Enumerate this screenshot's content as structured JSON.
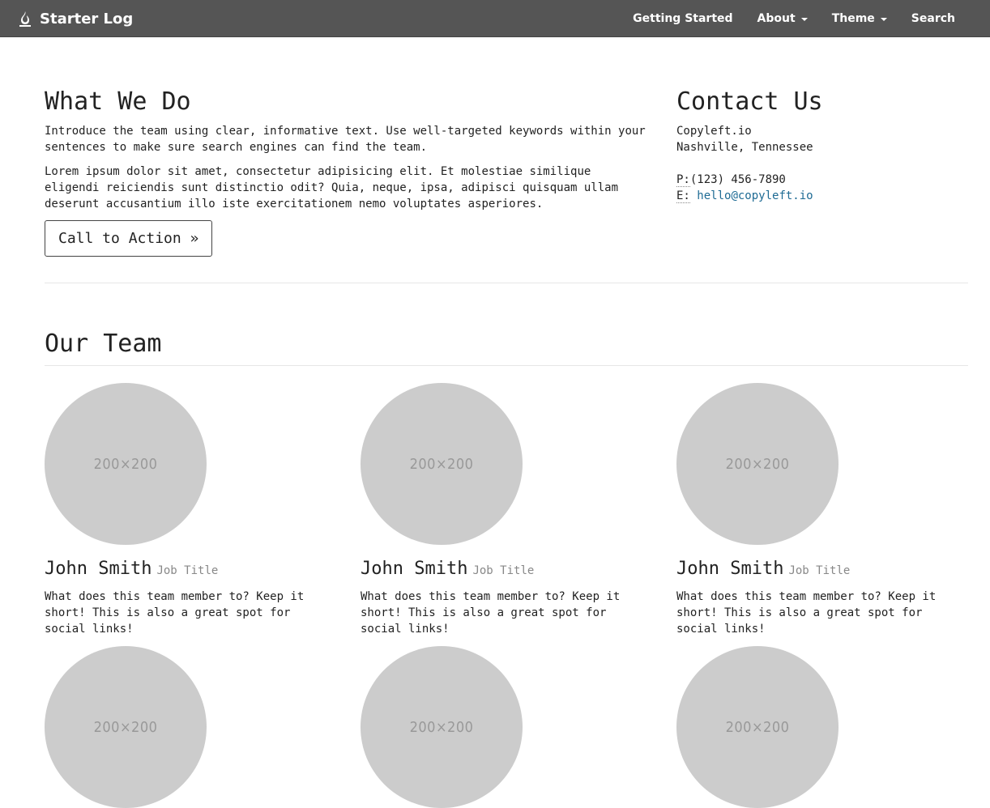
{
  "navbar": {
    "brand": "Starter Log",
    "links": [
      {
        "label": "Getting Started"
      },
      {
        "label": "About"
      },
      {
        "label": "Theme"
      },
      {
        "label": "Search"
      }
    ]
  },
  "what_we_do": {
    "heading": "What We Do",
    "paragraph_1": "Introduce the team using clear, informative text. Use well-targeted keywords within your sentences to make sure search engines can find the team.",
    "paragraph_2": "Lorem ipsum dolor sit amet, consectetur adipisicing elit. Et molestiae similique eligendi reiciendis sunt distinctio odit? Quia, neque, ipsa, adipisci quisquam ullam deserunt accusantium illo iste exercitationem nemo voluptates asperiores.",
    "cta_label": "Call to Action »"
  },
  "contact": {
    "heading": "Contact Us",
    "company": "Copyleft.io",
    "location": "Nashville, Tennessee",
    "phone_label": "P:",
    "phone": "(123) 456-7890",
    "email_label": "E:",
    "email": "hello@copyleft.io",
    "link_color": "#1e6b94"
  },
  "team": {
    "heading": "Our Team",
    "members": [
      {
        "avatar": "200×200",
        "name": "John Smith",
        "title": "Job Title",
        "description": "What does this team member to? Keep it short! This is also a great spot for social links!"
      },
      {
        "avatar": "200×200",
        "name": "John Smith",
        "title": "Job Title",
        "description": "What does this team member to? Keep it short! This is also a great spot for social links!"
      },
      {
        "avatar": "200×200",
        "name": "John Smith",
        "title": "Job Title",
        "description": "What does this team member to? Keep it short! This is also a great spot for social links!"
      },
      {
        "avatar": "200×200"
      },
      {
        "avatar": "200×200"
      },
      {
        "avatar": "200×200"
      }
    ]
  },
  "colors": {
    "navbar_bg": "#555555",
    "avatar_bg": "#cccccc"
  },
  "icons": {
    "brand": "flame-icon",
    "dropdown": "caret-down-icon"
  }
}
